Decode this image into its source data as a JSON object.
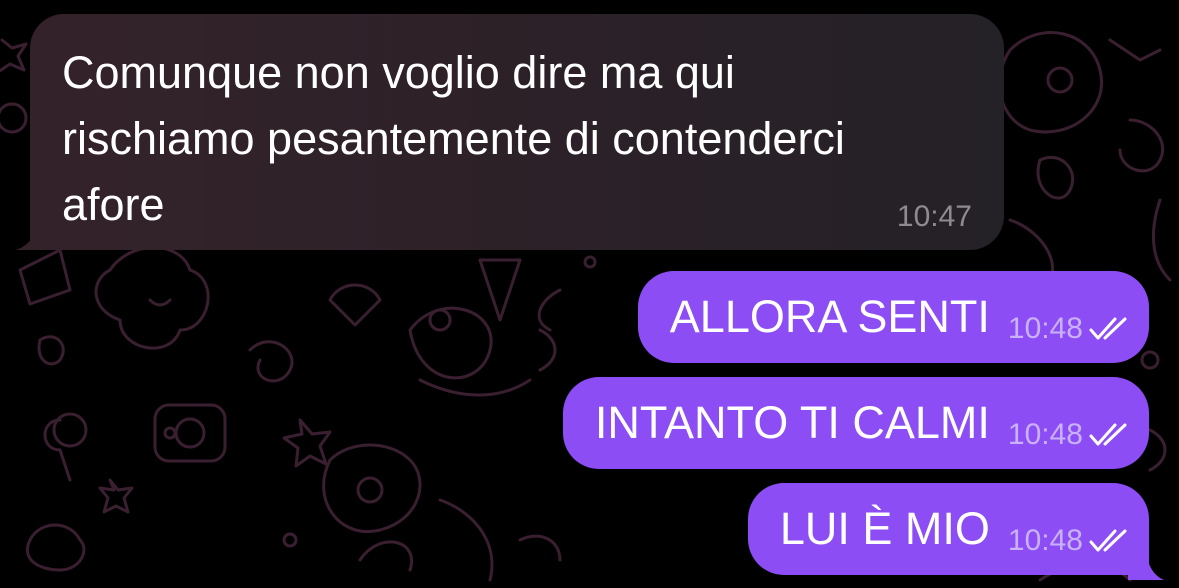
{
  "incoming": {
    "text": "Comunque non voglio dire ma qui\nrischiamo pesantemente di contenderci\nafore",
    "time": "10:47"
  },
  "outgoing": [
    {
      "text": "ALLORA SENTI",
      "time": "10:48"
    },
    {
      "text": "INTANTO TI CALMI",
      "time": "10:48"
    },
    {
      "text": "LUI È MIO",
      "time": "10:48"
    }
  ],
  "colors": {
    "background": "#000000",
    "incoming_bubble": "#2c2128",
    "outgoing_bubble": "#8d4df5",
    "outgoing_meta": "#c9b2fb",
    "incoming_meta": "#8f8a90"
  }
}
